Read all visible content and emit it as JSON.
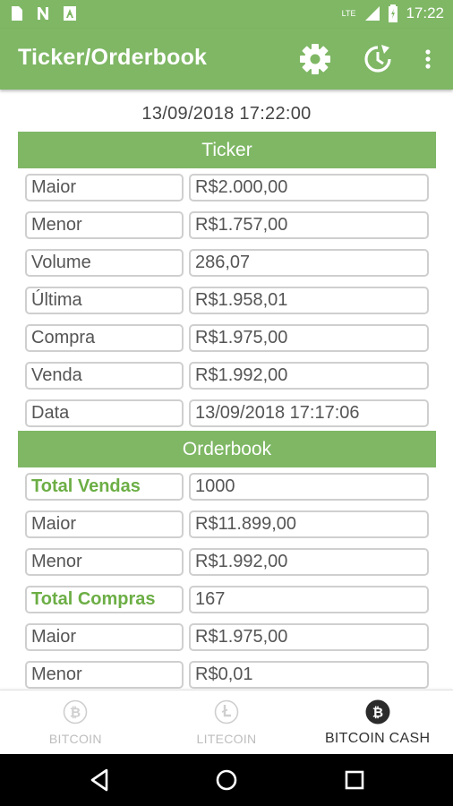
{
  "status_bar": {
    "time": "17:22",
    "network": "LTE",
    "left_icons": [
      "sd-card-icon",
      "n-icon",
      "a-icon"
    ]
  },
  "app_bar": {
    "title": "Ticker/Orderbook",
    "actions": [
      "settings-icon",
      "refresh-icon",
      "more-vert-icon"
    ]
  },
  "timestamp": "13/09/2018 17:22:00",
  "ticker": {
    "header": "Ticker",
    "rows": [
      {
        "label": "Maior",
        "value": "R$2.000,00"
      },
      {
        "label": "Menor",
        "value": "R$1.757,00"
      },
      {
        "label": "Volume",
        "value": "286,07"
      },
      {
        "label": "Última",
        "value": "R$1.958,01"
      },
      {
        "label": "Compra",
        "value": "R$1.975,00"
      },
      {
        "label": "Venda",
        "value": "R$1.992,00"
      },
      {
        "label": "Data",
        "value": "13/09/2018 17:17:06"
      }
    ]
  },
  "orderbook": {
    "header": "Orderbook",
    "rows": [
      {
        "label": "Total Vendas",
        "value": "1000",
        "highlight": true
      },
      {
        "label": "Maior",
        "value": "R$11.899,00",
        "highlight": false
      },
      {
        "label": "Menor",
        "value": "R$1.992,00",
        "highlight": false
      },
      {
        "label": "Total Compras",
        "value": "167",
        "highlight": true
      },
      {
        "label": "Maior",
        "value": "R$1.975,00",
        "highlight": false
      },
      {
        "label": "Menor",
        "value": "R$0,01",
        "highlight": false
      }
    ]
  },
  "bottom_nav": {
    "items": [
      {
        "label": "BITCOIN",
        "icon": "bitcoin-icon",
        "active": false
      },
      {
        "label": "LITECOIN",
        "icon": "litecoin-icon",
        "active": false
      },
      {
        "label": "BITCOIN CASH",
        "icon": "bitcoin-cash-icon",
        "active": true
      }
    ]
  },
  "colors": {
    "primary": "#7fb765",
    "highlight_text": "#6cae45"
  }
}
